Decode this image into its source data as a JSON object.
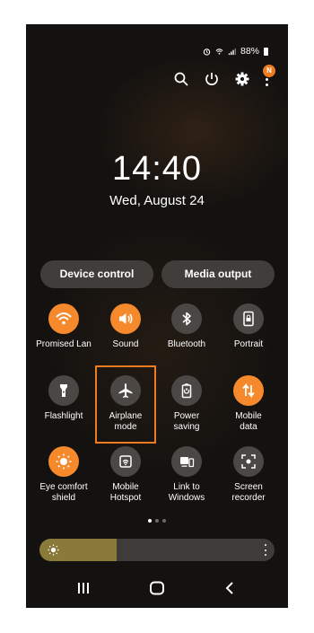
{
  "status_bar": {
    "battery": "88%",
    "icons": [
      "alarm-icon",
      "wifi-icon",
      "signal-icon",
      "battery-icon"
    ]
  },
  "header_icons": [
    "search-icon",
    "power-icon",
    "settings-icon",
    "more-icon"
  ],
  "notification_badge": "N",
  "clock": {
    "time": "14:40",
    "date": "Wed, August 24"
  },
  "pills": {
    "device_control": "Device control",
    "media_output": "Media output"
  },
  "tiles": [
    {
      "label": "Promised Lan",
      "icon": "wifi-icon",
      "on": true
    },
    {
      "label": "Sound",
      "icon": "sound-icon",
      "on": true
    },
    {
      "label": "Bluetooth",
      "icon": "bluetooth-icon",
      "on": false
    },
    {
      "label": "Portrait",
      "icon": "portrait-lock-icon",
      "on": false
    },
    {
      "label": "Flashlight",
      "icon": "flashlight-icon",
      "on": false
    },
    {
      "label": "Airplane\nmode",
      "icon": "airplane-icon",
      "on": false
    },
    {
      "label": "Power\nsaving",
      "icon": "power-saving-icon",
      "on": false
    },
    {
      "label": "Mobile\ndata",
      "icon": "mobile-data-icon",
      "on": true
    },
    {
      "label": "Eye comfort\nshield",
      "icon": "eye-comfort-icon",
      "on": true
    },
    {
      "label": "Mobile\nHotspot",
      "icon": "hotspot-icon",
      "on": false
    },
    {
      "label": "Link to\nWindows",
      "icon": "link-windows-icon",
      "on": false
    },
    {
      "label": "Screen\nrecorder",
      "icon": "screen-recorder-icon",
      "on": false
    }
  ],
  "highlighted_tile": "Airplane mode",
  "pager": {
    "pages": 3,
    "current": 1
  },
  "brightness": {
    "level": 0.33,
    "icon": "sun-icon"
  },
  "colors": {
    "accent": "#f5892b",
    "highlight_border": "#f07a1e",
    "tile_off": "#4a4745"
  },
  "nav_bar": [
    "recents-icon",
    "home-icon",
    "back-icon"
  ]
}
